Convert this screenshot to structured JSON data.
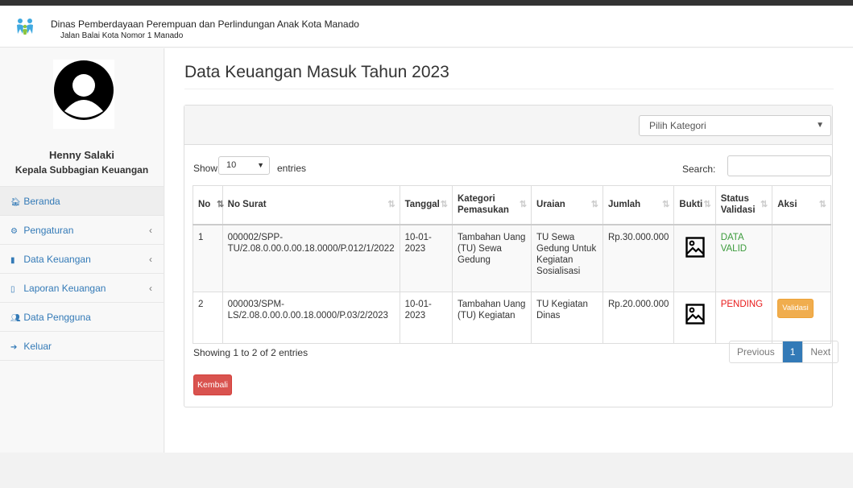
{
  "header": {
    "org_name": "Dinas Pemberdayaan Perempuan dan Perlindungan Anak Kota Manado",
    "address": "Jalan Balai Kota Nomor 1 Manado",
    "logo_icon": "family-logo-icon"
  },
  "profile": {
    "name": "Henny Salaki",
    "role": "Kepala Subbagian Keuangan",
    "avatar_icon": "user-avatar-icon"
  },
  "sidebar": {
    "items": [
      {
        "icon": "home-icon",
        "glyph": "🏠︎",
        "label": "Beranda",
        "has_caret": false
      },
      {
        "icon": "gear-icon",
        "glyph": "⚙",
        "label": "Pengaturan",
        "has_caret": true
      },
      {
        "icon": "file-icon",
        "glyph": "▮",
        "label": "Data Keuangan",
        "has_caret": true
      },
      {
        "icon": "file-outline-icon",
        "glyph": "▯",
        "label": "Laporan Keuangan",
        "has_caret": true
      },
      {
        "icon": "add-user-icon",
        "glyph": "👥︎",
        "label": "Data Pengguna",
        "has_caret": false
      },
      {
        "icon": "sign-out-icon",
        "glyph": "➔",
        "label": "Keluar",
        "has_caret": false
      }
    ],
    "caret": "‹"
  },
  "main": {
    "title": "Data Keuangan Masuk Tahun 2023",
    "category_select": "Pilih Kategori",
    "show_label": "Show",
    "page_length": "10",
    "entries_label": "entries",
    "search_label": "Search:",
    "search_value": ""
  },
  "table": {
    "columns": [
      "No",
      "No Surat",
      "Tanggal",
      "Kategori Pemasukan",
      "Uraian",
      "Jumlah",
      "Bukti",
      "Status Validasi",
      "Aksi"
    ],
    "rows": [
      {
        "no": "1",
        "no_surat": "000002/SPP-TU/2.08.0.00.0.00.18.0000/P.012/1/2022",
        "tanggal": "10-01-2023",
        "kategori": "Tambahan Uang (TU) Sewa Gedung",
        "uraian": "TU Sewa Gedung Untuk Kegiatan Sosialisasi",
        "jumlah": "Rp.30.000.000",
        "bukti_icon": "image-icon",
        "status": "DATA VALID",
        "aksi": ""
      },
      {
        "no": "2",
        "no_surat": "000003/SPM-LS/2.08.0.00.0.00.18.0000/P.03/2/2023",
        "tanggal": "10-01-2023",
        "kategori": "Tambahan Uang (TU) Kegiatan",
        "uraian": "TU Kegiatan Dinas",
        "jumlah": "Rp.20.000.000",
        "bukti_icon": "image-icon",
        "status": "PENDING",
        "aksi": "Validasi"
      }
    ]
  },
  "footer_table": {
    "info": "Showing 1 to 2 of 2 entries",
    "prev": "Previous",
    "page": "1",
    "next": "Next",
    "back_button": "Kembali"
  },
  "colors": {
    "link": "#337ab7",
    "valid": "#3c9b3c",
    "pending": "#e81a1a",
    "warning_button": "#f0ad4e",
    "danger_button": "#d9534f"
  }
}
